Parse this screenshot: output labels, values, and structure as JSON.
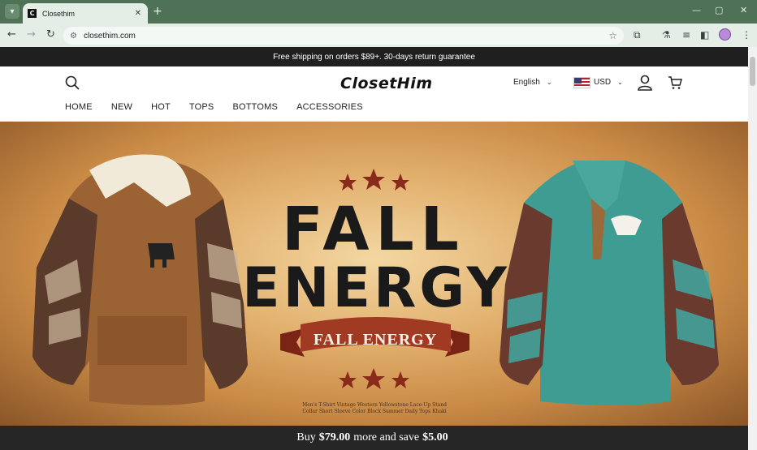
{
  "browser": {
    "tab_title": "Closethim",
    "favicon_letter": "C",
    "url": "closethim.com",
    "new_tab_symbol": "+",
    "close_symbol": "✕"
  },
  "site": {
    "announcement": "Free shipping on orders $89+. 30-days return guarantee",
    "logo": "ClosetHim",
    "language": "English",
    "currency": "USD",
    "nav": [
      "HOME",
      "NEW",
      "HOT",
      "TOPS",
      "BOTTOMS",
      "ACCESSORIES"
    ]
  },
  "hero": {
    "headline_1": "FALL",
    "headline_2": "ENERGY",
    "ribbon": "FALL ENERGY",
    "caption": "Men's T-Shirt Vintage Western Yellowstone Lace-Up Stand Collar Short Sleeve Color Block Summer Daily Tops Khaki"
  },
  "promo": {
    "prefix": "Buy",
    "amount_1": "$79.00",
    "middle": "more and save",
    "amount_2": "$5.00"
  },
  "colors": {
    "chrome": "#4f7257",
    "toolbar": "#e4ede6",
    "announcement_bg": "#1f1f1f",
    "promo_bg": "#262626"
  }
}
